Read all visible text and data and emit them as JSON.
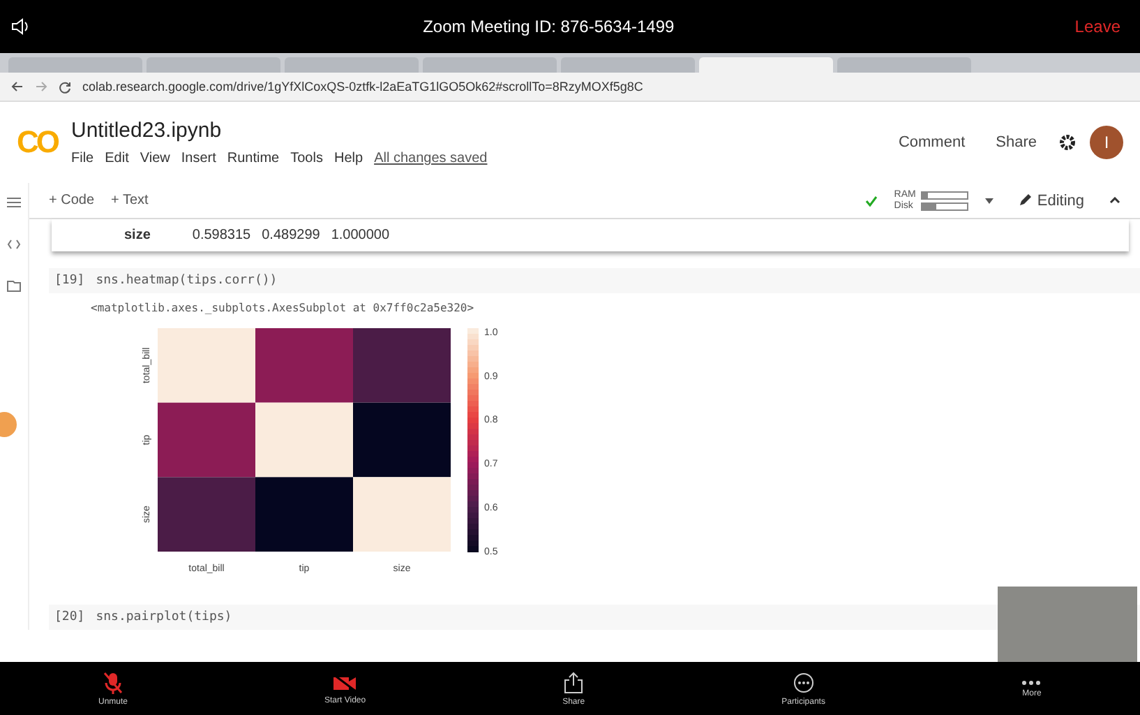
{
  "meeting": {
    "title": "Zoom Meeting ID: 876-5634-1499",
    "leave": "Leave"
  },
  "browser": {
    "tabs": [
      {
        "selected": false
      },
      {
        "selected": false
      },
      {
        "selected": false
      },
      {
        "selected": false
      },
      {
        "selected": false
      },
      {
        "selected": true
      },
      {
        "selected": false
      }
    ],
    "url": "colab.research.google.com/drive/1gYfXlCoxQS-0ztfk-l2aEaTG1lGO5Ok62#scrollTo=8RzyMOXf5g8C"
  },
  "notebook": {
    "logo": "CO",
    "title": "Untitled23.ipynb",
    "menu": [
      "File",
      "Edit",
      "View",
      "Insert",
      "Runtime",
      "Tools",
      "Help"
    ],
    "save_status": "All changes saved",
    "actions": [
      "Comment",
      "Share"
    ],
    "avatar": "I"
  },
  "toolbar": {
    "add": [
      "+ Code",
      "+ Text"
    ],
    "ram": {
      "label": "RAM",
      "level": 0.1
    },
    "disk": {
      "label": "Disk",
      "level": 0.3
    },
    "mode": "Editing"
  },
  "output_row": {
    "label": "size",
    "values": [
      "0.598315",
      "0.489299",
      "1.000000"
    ]
  },
  "cells": [
    {
      "number": "[19]",
      "code": "sns.heatmap(tips.corr())",
      "output": "<matplotlib.axes._subplots.AxesSubplot at 0x7ff0c2a5e320>",
      "heatmap": {
        "y_labels": [
          "total_bill",
          "tip",
          "size"
        ],
        "x_labels": [
          "total_bill",
          "tip",
          "size"
        ],
        "cells": [
          {
            "color": "#faebdd"
          },
          {
            "color": "#8c1c55"
          },
          {
            "color": "#4b1c47"
          },
          {
            "color": "#8c1c55"
          },
          {
            "color": "#faebdd"
          },
          {
            "color": "#050620"
          },
          {
            "color": "#4b1c47"
          },
          {
            "color": "#050620"
          },
          {
            "color": "#faebdd"
          }
        ],
        "colorbar_ticks": [
          "1.0",
          "0.9",
          "0.8",
          "0.7",
          "0.6",
          "0.5"
        ]
      }
    },
    {
      "number": "[20]",
      "code": "sns.pairplot(tips)"
    }
  ],
  "controls": [
    {
      "label": "Unmute",
      "kind": "mic"
    },
    {
      "label": "Start Video",
      "kind": "video"
    },
    {
      "label": "Share",
      "kind": "share"
    },
    {
      "label": "Participants",
      "kind": "chat"
    },
    {
      "label": "More",
      "kind": "more"
    }
  ]
}
